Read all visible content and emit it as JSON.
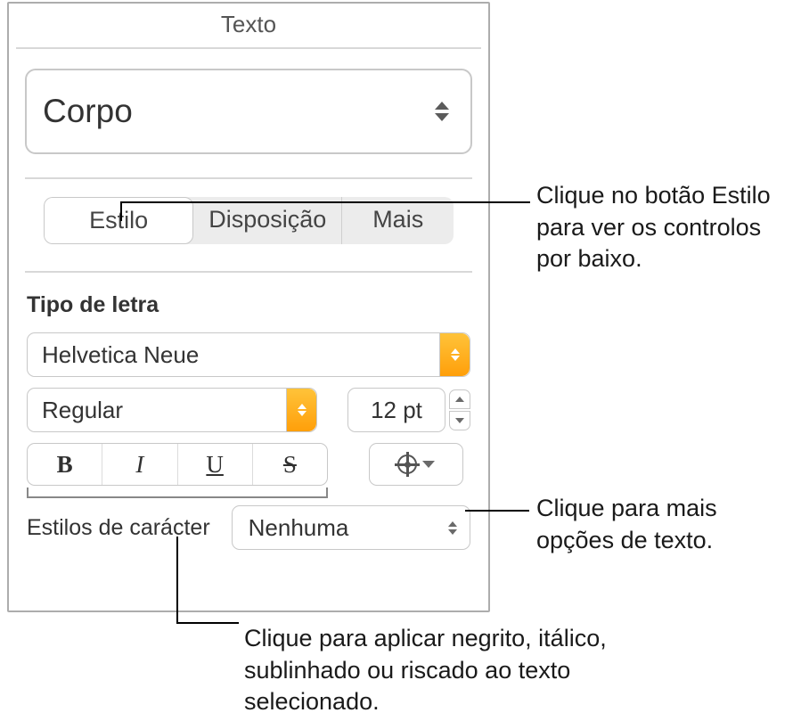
{
  "panel": {
    "title": "Texto",
    "paragraph_style": "Corpo",
    "tabs": {
      "style": "Estilo",
      "layout": "Disposição",
      "more": "Mais"
    },
    "section_font": "Tipo de letra",
    "font_family": "Helvetica Neue",
    "font_typeface": "Regular",
    "font_size": "12 pt",
    "bold": "B",
    "italic": "I",
    "underline": "U",
    "strike": "S",
    "char_styles_label": "Estilos de carácter",
    "char_style_value": "Nenhuma"
  },
  "callouts": {
    "style_tab": "Clique no botão Estilo para ver os controlos por baixo.",
    "gear": "Clique para mais opções de texto.",
    "bius": "Clique para aplicar negrito, itálico, sublinhado ou riscado ao texto selecionado."
  }
}
